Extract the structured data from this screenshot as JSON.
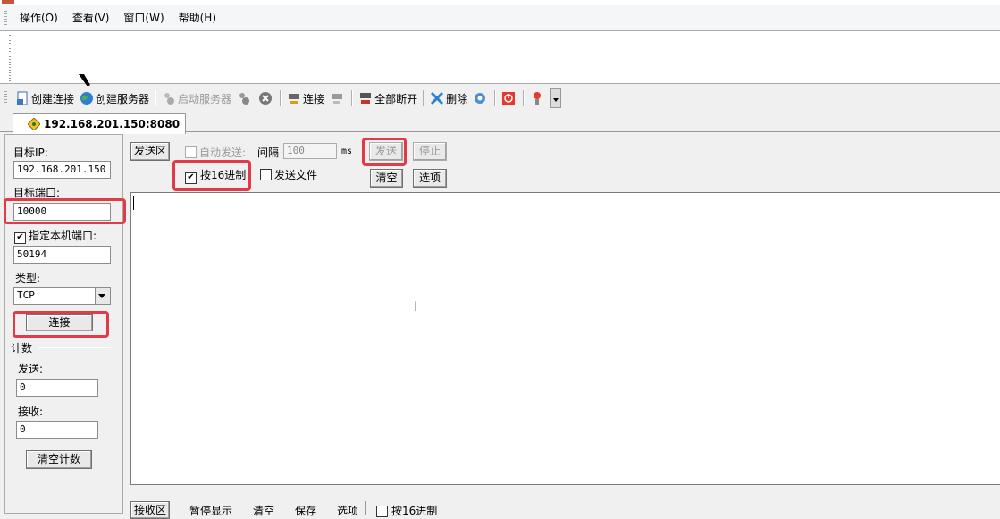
{
  "menu": {
    "items": [
      "操作(O)",
      "查看(V)",
      "窗口(W)",
      "帮助(H)"
    ]
  },
  "toolbar": {
    "create_connection": "创建连接",
    "create_server": "创建服务器",
    "start_server": "启动服务器",
    "connect": "连接",
    "disconnect_all": "全部断开",
    "delete": "删除"
  },
  "tab": {
    "label": "192.168.201.150:8080"
  },
  "left": {
    "target_ip_label": "目标IP:",
    "target_ip_value": "192.168.201.150",
    "target_port_label": "目标端口:",
    "target_port_value": "10000",
    "local_port_label": "指定本机端口:",
    "local_port_checked": true,
    "local_port_value": "50194",
    "type_label": "类型:",
    "type_value": "TCP",
    "connect_button": "连接",
    "count_label": "计数",
    "sent_label": "发送:",
    "sent_value": "0",
    "recv_label": "接收:",
    "recv_value": "0",
    "clear_count_button": "清空计数"
  },
  "send": {
    "area_label": "发送区",
    "auto_send_label": "自动发送:",
    "interval_label": "间隔",
    "interval_value": "100",
    "interval_unit": "ms",
    "send_button": "发送",
    "stop_button": "停止",
    "hex_label": "按16进制",
    "hex_checked": true,
    "send_file_label": "发送文件",
    "clear_button": "清空",
    "options_button": "选项"
  },
  "recv": {
    "area_label": "接收区",
    "pause_label": "暂停显示",
    "clear_label": "清空",
    "save_label": "保存",
    "options_label": "选项",
    "hex_label": "按16进制"
  },
  "colors": {
    "highlight": "#e03b47"
  }
}
